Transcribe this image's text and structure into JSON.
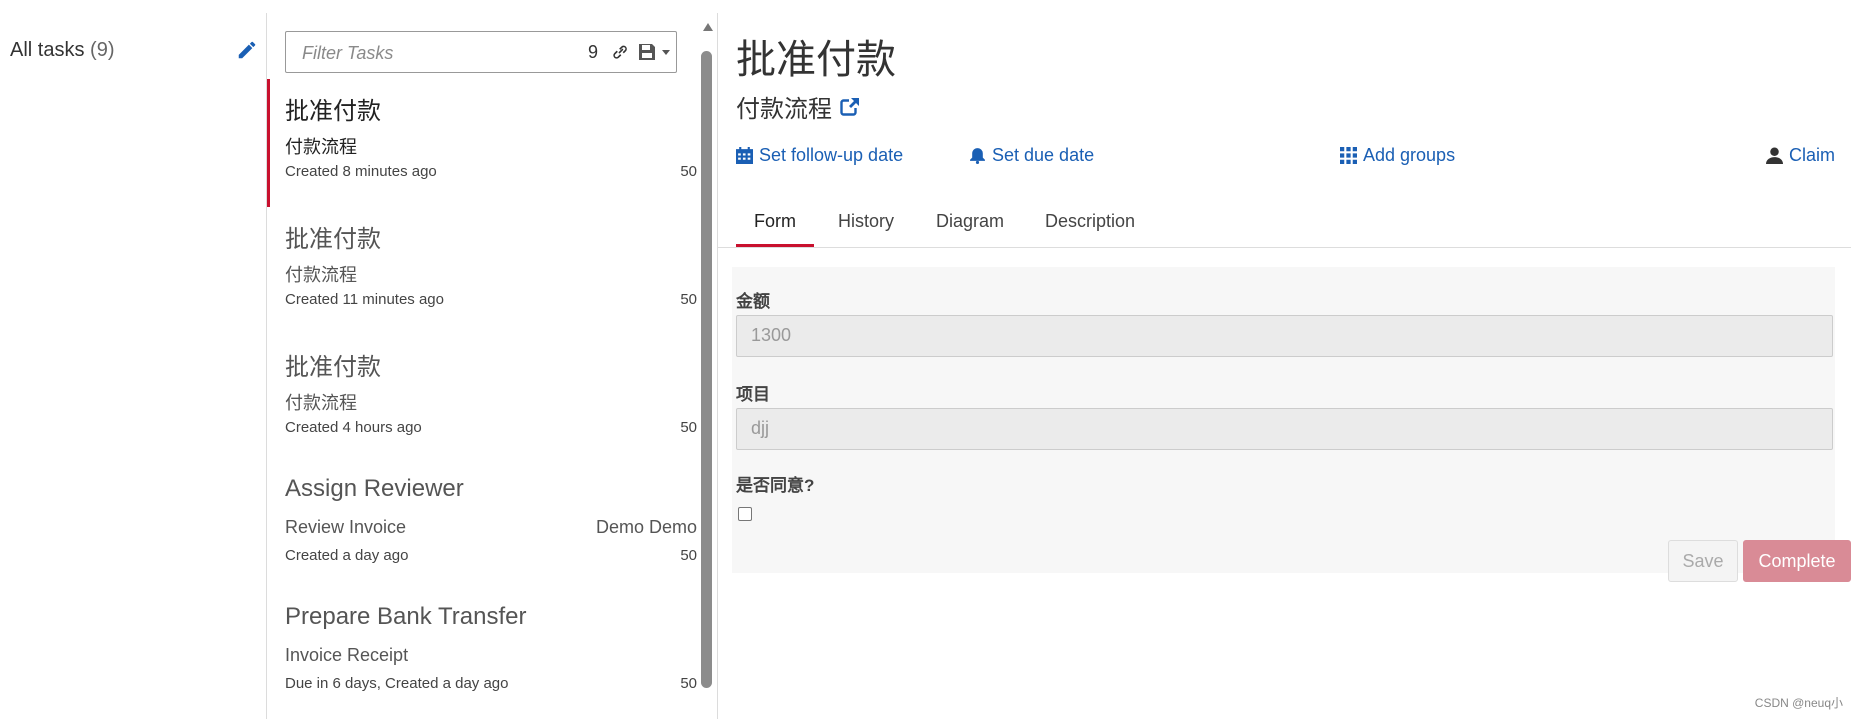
{
  "filters": {
    "label": "All tasks",
    "count": "(9)"
  },
  "tasklist": {
    "filter_placeholder": "Filter Tasks",
    "count": "9",
    "tasks": [
      {
        "name": "批准付款",
        "process": "付款流程",
        "assignee": "",
        "meta": "Created 8 minutes ago",
        "priority": "50"
      },
      {
        "name": "批准付款",
        "process": "付款流程",
        "assignee": "",
        "meta": "Created 11 minutes ago",
        "priority": "50"
      },
      {
        "name": "批准付款",
        "process": "付款流程",
        "assignee": "",
        "meta": "Created 4 hours ago",
        "priority": "50"
      },
      {
        "name": "Assign Reviewer",
        "process": "Review Invoice",
        "assignee": "Demo Demo",
        "meta": "Created a day ago",
        "priority": "50"
      },
      {
        "name": "Prepare Bank Transfer",
        "process": "Invoice Receipt",
        "assignee": "",
        "meta": "Due in 6 days, Created a day ago",
        "priority": "50"
      }
    ]
  },
  "detail": {
    "title": "批准付款",
    "process": "付款流程",
    "actions": {
      "followup": "Set follow-up date",
      "due": "Set due date",
      "groups": "Add groups",
      "claim": "Claim"
    },
    "tabs": [
      "Form",
      "History",
      "Diagram",
      "Description"
    ],
    "form": {
      "amount_label": "金额",
      "amount_value": "1300",
      "item_label": "项目",
      "item_value": "djj",
      "agree_label": "是否同意?",
      "agree_checked": false
    },
    "buttons": {
      "save": "Save",
      "complete": "Complete"
    }
  },
  "watermark": "CSDN @neuq小",
  "colors": {
    "accent": "#c8102e",
    "link": "#1a5fb4",
    "complete_button": "#d98b96"
  }
}
